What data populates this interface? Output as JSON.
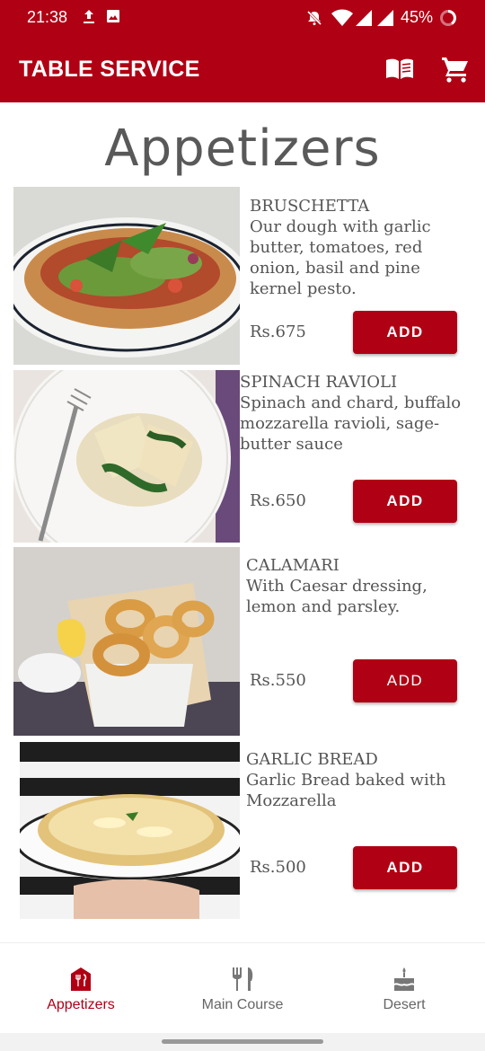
{
  "status_bar": {
    "time": "21:38",
    "battery_percent": "45%"
  },
  "app_bar": {
    "title": "TABLE SERVICE",
    "icons": [
      "menu-book-icon",
      "shopping-cart-icon"
    ]
  },
  "page": {
    "title": "Appetizers"
  },
  "items": [
    {
      "name": "BRUSCHETTA",
      "description": "Our dough with garlic butter, tomatoes, red onion, basil and pine kernel pesto.",
      "price": "Rs.675",
      "add_label": "ADD"
    },
    {
      "name": "SPINACH RAVIOLI",
      "description": "Spinach and chard, buffalo mozzarella ravioli, sage-butter sauce",
      "price": "Rs.650",
      "add_label": "ADD"
    },
    {
      "name": "CALAMARI",
      "description": "With Caesar dressing, lemon and parsley.",
      "price": "Rs.550",
      "add_label": "ADD"
    },
    {
      "name": "GARLIC BREAD",
      "description": "Garlic Bread baked with Mozzarella",
      "price": "Rs.500",
      "add_label": "ADD"
    }
  ],
  "bottom_nav": {
    "tabs": [
      {
        "label": "Appetizers",
        "icon": "restaurant-icon",
        "active": true
      },
      {
        "label": "Main Course",
        "icon": "fork-knife-icon",
        "active": false
      },
      {
        "label": "Desert",
        "icon": "cake-icon",
        "active": false
      }
    ]
  },
  "colors": {
    "brand": "#b00014",
    "text": "#555555"
  }
}
